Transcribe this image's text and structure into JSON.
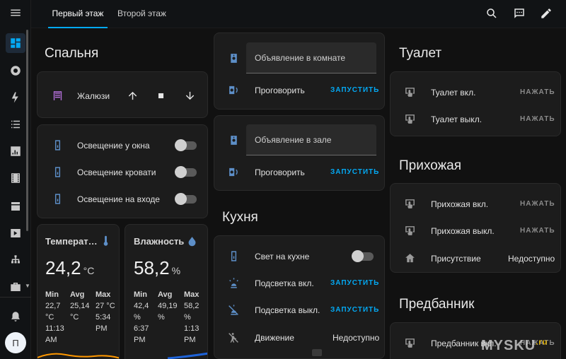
{
  "header": {
    "tabs": [
      "Первый этаж",
      "Второй этаж"
    ]
  },
  "sidebar": {
    "avatar_letter": "П",
    "icons": [
      "menu-icon",
      "dashboard-icon",
      "aperture-icon",
      "lightning-icon",
      "list-icon",
      "chart-icon",
      "film-icon",
      "hacs-icon",
      "media-icon",
      "network-icon",
      "toolbox-icon",
      "bell-icon"
    ]
  },
  "bedroom": {
    "title": "Спальня",
    "blinds_label": "Жалюзи",
    "lights": [
      {
        "label": "Освещение у окна"
      },
      {
        "label": "Освещение кровати"
      },
      {
        "label": "Освещение на входе"
      }
    ],
    "temperature": {
      "title": "Температ…",
      "value": "24,2",
      "unit": "°C",
      "min_label": "Min",
      "avg_label": "Avg",
      "max_label": "Max",
      "min": [
        "22,7",
        "°C",
        "11:13",
        "AM"
      ],
      "avg": [
        "25,14",
        "°C"
      ],
      "max": [
        "27 °C",
        "5:34",
        "PM"
      ]
    },
    "humidity": {
      "title": "Влажность",
      "value": "58,2",
      "unit": "%",
      "min_label": "Min",
      "avg_label": "Avg",
      "max_label": "Max",
      "min": [
        "42,4",
        "%",
        "6:37",
        "PM"
      ],
      "avg": [
        "49,19",
        "%"
      ],
      "max": [
        "58,2",
        "%",
        "1:13",
        "PM"
      ]
    }
  },
  "announce_room": {
    "input": "Объявление в комнате",
    "speak_label": "Проговорить",
    "action": "ЗАПУСТИТЬ"
  },
  "announce_hall": {
    "input": "Объявление в зале",
    "speak_label": "Проговорить",
    "action": "ЗАПУСТИТЬ"
  },
  "kitchen": {
    "title": "Кухня",
    "light_label": "Свет на кухне",
    "rows": [
      {
        "label": "Подсветка вкл.",
        "action": "ЗАПУСТИТЬ"
      },
      {
        "label": "Подсветка выкл.",
        "action": "ЗАПУСТИТЬ"
      }
    ],
    "motion_label": "Движение",
    "motion_state": "Недоступно"
  },
  "toilet": {
    "title": "Туалет",
    "rows": [
      {
        "label": "Туалет вкл.",
        "action": "НАЖАТЬ"
      },
      {
        "label": "Туалет выкл.",
        "action": "НАЖАТЬ"
      }
    ]
  },
  "hallway": {
    "title": "Прихожая",
    "rows": [
      {
        "label": "Прихожая вкл.",
        "action": "НАЖАТЬ"
      },
      {
        "label": "Прихожая выкл.",
        "action": "НАЖАТЬ"
      }
    ],
    "presence_label": "Присутствие",
    "presence_state": "Недоступно"
  },
  "predbannik": {
    "title": "Предбанник",
    "row_label": "Предбанник вкл.",
    "row_action": "НАЖАТЬ"
  },
  "watermark": {
    "text": "MYSKU",
    "suffix": ".ru"
  },
  "colors": {
    "accent": "#03a9f4",
    "icon": "#5d8fc8",
    "card": "#1c1c1c",
    "background": "#111111"
  }
}
